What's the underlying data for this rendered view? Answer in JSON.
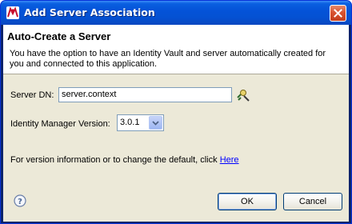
{
  "window": {
    "title": "Add Server Association"
  },
  "banner": {
    "title": "Auto-Create a Server",
    "description": "You have the option to have an Identity Vault and server automatically created for you and connected to this application."
  },
  "form": {
    "server_dn_label": "Server DN:",
    "server_dn_value": "server.context",
    "idm_version_label": "Identity Manager Version:",
    "idm_version_selected": "3.0.1",
    "version_info_text": "For version information or to change the default, click ",
    "version_info_link": "Here"
  },
  "buttons": {
    "ok": "OK",
    "cancel": "Cancel"
  },
  "colors": {
    "titlebar": "#0453d8",
    "client_bg": "#ece9d8",
    "link": "#0000ff",
    "close": "#d9532f"
  }
}
